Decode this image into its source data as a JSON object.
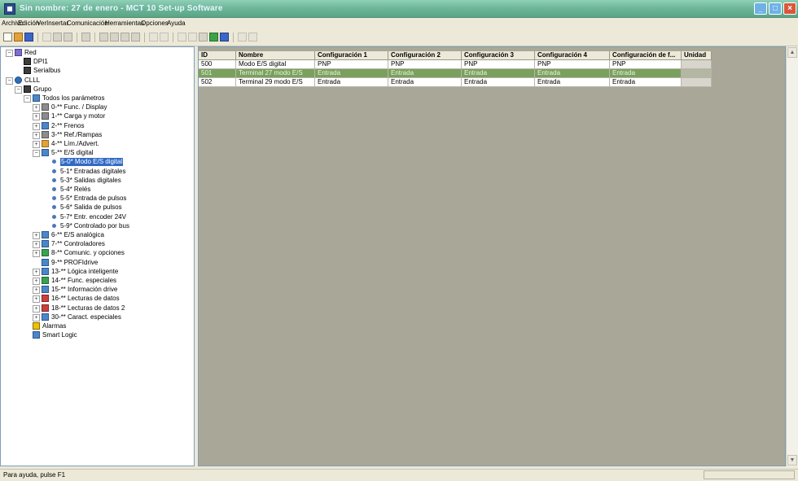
{
  "window": {
    "title": "Sin nombre: 27 de enero - MCT 10 Set-up Software"
  },
  "menu": [
    "Archivo",
    "Edición",
    "Ver",
    "Insertar",
    "Comunicación",
    "Herramientas",
    "Opciones",
    "Ayuda"
  ],
  "tree": {
    "items": [
      {
        "label": "Red",
        "level": 0,
        "expander": "−",
        "icon": "user"
      },
      {
        "label": "DPI1",
        "level": 1,
        "expander": "",
        "icon": "dev"
      },
      {
        "label": "Serialbus",
        "level": 1,
        "expander": "",
        "icon": "dev"
      },
      {
        "label": "CLLL",
        "level": 0,
        "expander": "−",
        "icon": "globe"
      },
      {
        "label": "Grupo",
        "level": 1,
        "expander": "−",
        "icon": "dev"
      },
      {
        "label": "Todos los parámetros",
        "level": 2,
        "expander": "−",
        "icon": "list"
      },
      {
        "label": "0-** Func. / Display",
        "level": 3,
        "expander": "+",
        "icon": "gray"
      },
      {
        "label": "1-** Carga y motor",
        "level": 3,
        "expander": "+",
        "icon": "gray"
      },
      {
        "label": "2-** Frenos",
        "level": 3,
        "expander": "+",
        "icon": "list"
      },
      {
        "label": "3-** Ref./Rampas",
        "level": 3,
        "expander": "+",
        "icon": "gray"
      },
      {
        "label": "4-** Lím./Advert.",
        "level": 3,
        "expander": "+",
        "icon": "orange"
      },
      {
        "label": "5-** E/S digital",
        "level": 3,
        "expander": "−",
        "icon": "list"
      },
      {
        "label": "5-0* Modo E/S digital",
        "level": 4,
        "expander": "",
        "icon": "dot",
        "selected": true
      },
      {
        "label": "5-1* Entradas digitales",
        "level": 4,
        "expander": "",
        "icon": "dot"
      },
      {
        "label": "5-3* Salidas digitales",
        "level": 4,
        "expander": "",
        "icon": "dot"
      },
      {
        "label": "5-4* Relés",
        "level": 4,
        "expander": "",
        "icon": "dot"
      },
      {
        "label": "5-5* Entrada de pulsos",
        "level": 4,
        "expander": "",
        "icon": "dot"
      },
      {
        "label": "5-6* Salida de pulsos",
        "level": 4,
        "expander": "",
        "icon": "dot"
      },
      {
        "label": "5-7* Entr. encoder 24V",
        "level": 4,
        "expander": "",
        "icon": "dot"
      },
      {
        "label": "5-9* Controlado por bus",
        "level": 4,
        "expander": "",
        "icon": "dot"
      },
      {
        "label": "6-** E/S analógica",
        "level": 3,
        "expander": "+",
        "icon": "list"
      },
      {
        "label": "7-** Controladores",
        "level": 3,
        "expander": "+",
        "icon": "list"
      },
      {
        "label": "8-** Comunic. y opciones",
        "level": 3,
        "expander": "+",
        "icon": "green"
      },
      {
        "label": "9-** PROFIdrive",
        "level": 3,
        "expander": "",
        "icon": "list"
      },
      {
        "label": "13-** Lógica inteligente",
        "level": 3,
        "expander": "+",
        "icon": "list"
      },
      {
        "label": "14-** Func. especiales",
        "level": 3,
        "expander": "+",
        "icon": "green"
      },
      {
        "label": "15-** Información drive",
        "level": 3,
        "expander": "+",
        "icon": "list"
      },
      {
        "label": "16-** Lecturas de datos",
        "level": 3,
        "expander": "+",
        "icon": "red"
      },
      {
        "label": "18-** Lecturas de datos 2",
        "level": 3,
        "expander": "+",
        "icon": "red"
      },
      {
        "label": "30-** Caract. especiales",
        "level": 3,
        "expander": "+",
        "icon": "list"
      },
      {
        "label": "Alarmas",
        "level": 2,
        "expander": "",
        "icon": "warn"
      },
      {
        "label": "Smart Logic",
        "level": 2,
        "expander": "",
        "icon": "list"
      }
    ]
  },
  "grid": {
    "columns": [
      "ID",
      "Nombre",
      "Configuración 1",
      "Configuración 2",
      "Configuración 3",
      "Configuración 4",
      "Configuración de f...",
      "Unidad"
    ],
    "rows": [
      {
        "style": "white",
        "cells": [
          "500",
          "Modo E/S digital",
          "PNP",
          "PNP",
          "PNP",
          "PNP",
          "PNP",
          ""
        ]
      },
      {
        "style": "green",
        "cells": [
          "501",
          "Terminal 27 modo E/S",
          "Entrada",
          "Entrada",
          "Entrada",
          "Entrada",
          "Entrada",
          ""
        ]
      },
      {
        "style": "white",
        "cells": [
          "502",
          "Terminal 29 modo E/S",
          "Entrada",
          "Entrada",
          "Entrada",
          "Entrada",
          "Entrada",
          ""
        ]
      }
    ]
  },
  "status": {
    "text": "Para ayuda, pulse F1"
  }
}
